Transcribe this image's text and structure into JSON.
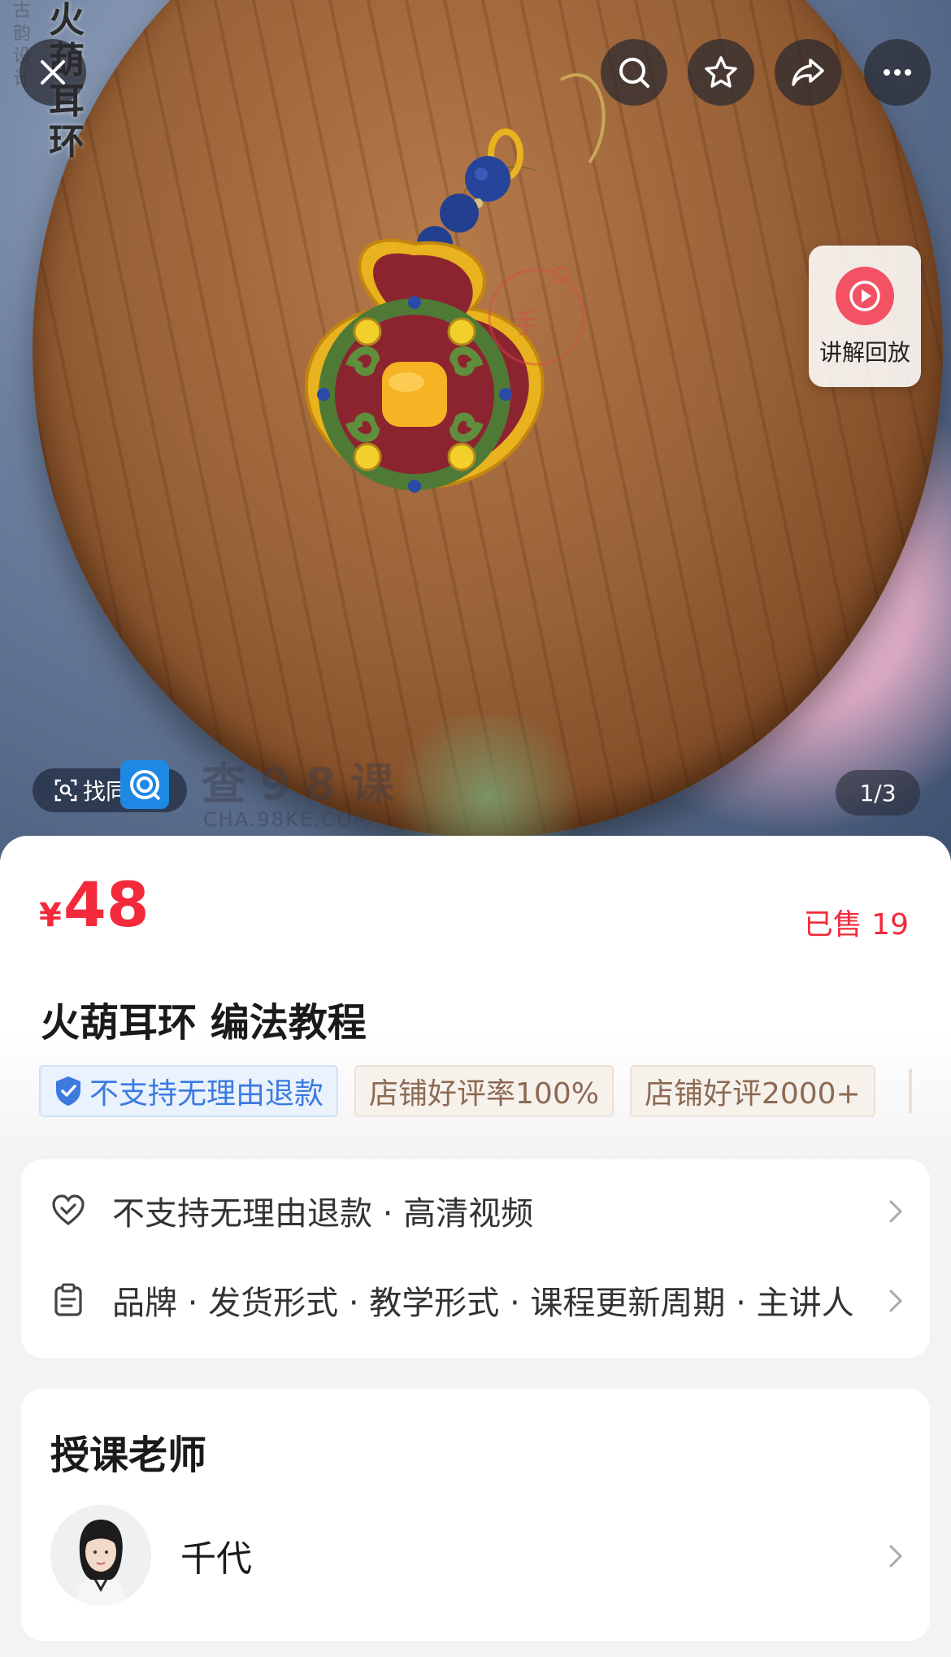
{
  "hero": {
    "side_title": "火葫耳环",
    "side_sub": "古韵设计",
    "replay_label": "讲解回放",
    "find_label": "找同款",
    "watermark_text": "查98课",
    "watermark_url": "CHA.98KE.COM",
    "page_indicator": "1/3",
    "icons": [
      "close-icon",
      "search-icon",
      "star-icon",
      "share-icon",
      "more-icon",
      "play-icon",
      "scan-icon"
    ]
  },
  "product": {
    "currency": "¥",
    "price": "48",
    "sold": "已售 19",
    "title": "火葫耳环 编法教程",
    "tags": [
      "不支持无理由退款",
      "店铺好评率100%",
      "店铺好评2000+"
    ]
  },
  "info_rows": [
    {
      "text": "不支持无理由退款 · 高清视频"
    },
    {
      "text": "品牌 · 发货形式 · 教学形式 · 课程更新周期 · 主讲人"
    }
  ],
  "teacher_section": {
    "heading": "授课老师",
    "name": "千代"
  },
  "colors": {
    "price_red": "#f22a3b",
    "replay_pink": "#f35264",
    "tag_blue": "#3c7ae0",
    "tag_brown": "#8c6a52"
  }
}
